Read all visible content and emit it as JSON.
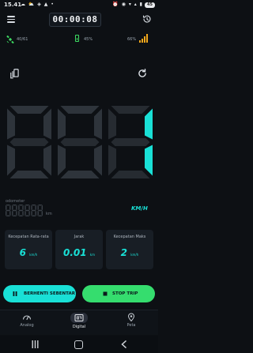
{
  "status_bar": {
    "time": "15.41",
    "left_icons": "☁ ⛅ ◈ ▲ •",
    "right_icons": "⏰ ◉ ▾ ▴ ▮",
    "battery": "45"
  },
  "toolbar": {
    "timer": "00:00:08",
    "menu_icon": "hamburger-icon",
    "history_icon": "history-icon"
  },
  "info": {
    "satellites": "40/61",
    "battery_pct": "45%",
    "signal_pct": "66%"
  },
  "display": {
    "speed_digits": "001",
    "unit": "KM/H",
    "accent": "#19e0d6"
  },
  "odometer": {
    "label": "odometer",
    "value": "000000",
    "unit": "km"
  },
  "stats": [
    {
      "title": "Kecepatan Rata-rata",
      "value": "6",
      "unit": "km/h"
    },
    {
      "title": "Jarak",
      "value": "0.01",
      "unit": "km"
    },
    {
      "title": "Kecepatan Maks",
      "value": "2",
      "unit": "km/h"
    }
  ],
  "buttons": {
    "pause": "BERHENTI SEBENTAR",
    "stop": "STOP TRIP"
  },
  "nav": [
    {
      "label": "Analog",
      "icon": "speedometer-icon"
    },
    {
      "label": "Digital",
      "icon": "digital-display-icon"
    },
    {
      "label": "Peta",
      "icon": "map-pin-icon"
    }
  ]
}
